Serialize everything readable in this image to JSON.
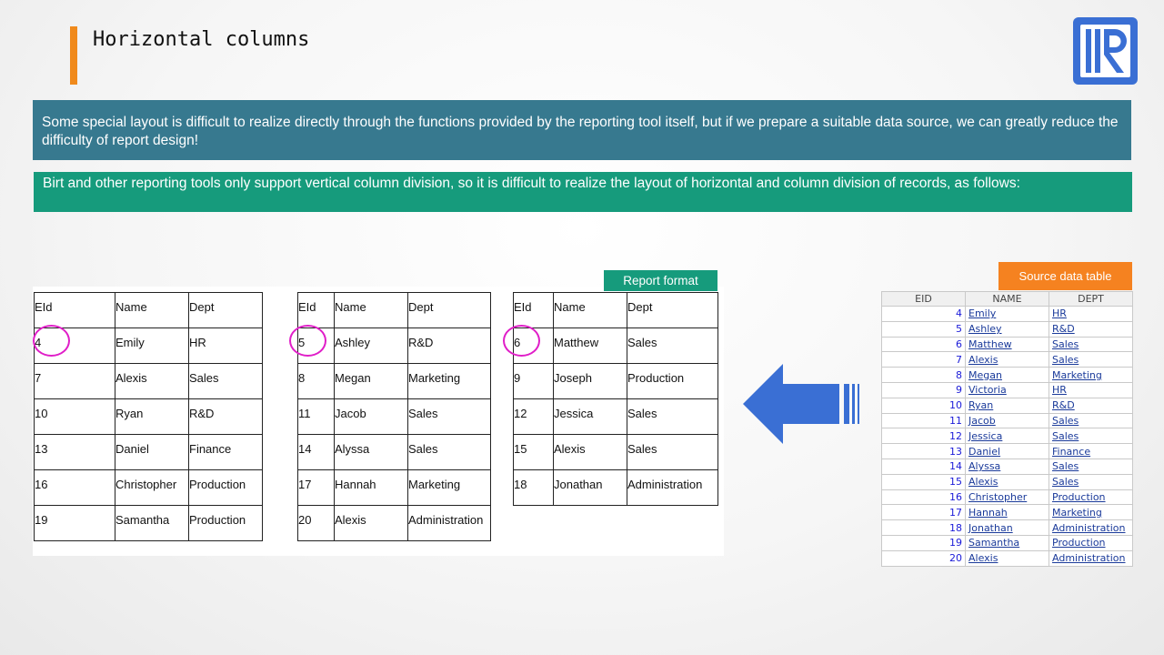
{
  "title": "Horizontal columns",
  "intro": "Some special layout is difficult to realize directly through the functions provided by the reporting tool itself, but if we prepare a suitable data source, we can greatly reduce the difficulty of report design!",
  "note": "Birt and other reporting tools only support vertical column division, so it is difficult to realize the layout of horizontal and column division of records, as follows:",
  "report_label": "Report format",
  "source_label": "Source data table",
  "report": {
    "headers": [
      "EId",
      "Name",
      "Dept"
    ],
    "groups": [
      [
        [
          "4",
          "Emily",
          "HR"
        ],
        [
          "7",
          "Alexis",
          "Sales"
        ],
        [
          "10",
          "Ryan",
          "R&D"
        ],
        [
          "13",
          "Daniel",
          "Finance"
        ],
        [
          "16",
          "Christopher",
          "Production"
        ],
        [
          "19",
          "Samantha",
          "Production"
        ]
      ],
      [
        [
          "5",
          "Ashley",
          "R&D"
        ],
        [
          "8",
          "Megan",
          "Marketing"
        ],
        [
          "11",
          "Jacob",
          "Sales"
        ],
        [
          "14",
          "Alyssa",
          "Sales"
        ],
        [
          "17",
          "Hannah",
          "Marketing"
        ],
        [
          "20",
          "Alexis",
          "Administration"
        ]
      ],
      [
        [
          "6",
          "Matthew",
          "Sales"
        ],
        [
          "9",
          "Joseph",
          "Production"
        ],
        [
          "12",
          "Jessica",
          "Sales"
        ],
        [
          "15",
          "Alexis",
          "Sales"
        ],
        [
          "18",
          "Jonathan",
          "Administration"
        ]
      ]
    ]
  },
  "source": {
    "headers": [
      "EID",
      "NAME",
      "DEPT"
    ],
    "rows": [
      [
        "4",
        "Emily",
        "HR"
      ],
      [
        "5",
        "Ashley",
        "R&D"
      ],
      [
        "6",
        "Matthew",
        "Sales"
      ],
      [
        "7",
        "Alexis",
        "Sales"
      ],
      [
        "8",
        "Megan",
        "Marketing"
      ],
      [
        "9",
        "Victoria",
        "HR"
      ],
      [
        "10",
        "Ryan",
        "R&D"
      ],
      [
        "11",
        "Jacob",
        "Sales"
      ],
      [
        "12",
        "Jessica",
        "Sales"
      ],
      [
        "13",
        "Daniel",
        "Finance"
      ],
      [
        "14",
        "Alyssa",
        "Sales"
      ],
      [
        "15",
        "Alexis",
        "Sales"
      ],
      [
        "16",
        "Christopher",
        "Production"
      ],
      [
        "17",
        "Hannah",
        "Marketing"
      ],
      [
        "18",
        "Jonathan",
        "Administration"
      ],
      [
        "19",
        "Samantha",
        "Production"
      ],
      [
        "20",
        "Alexis",
        "Administration"
      ]
    ]
  },
  "colors": {
    "accent": "#f08a1c",
    "band_blue": "#37798f",
    "band_green": "#169b7c",
    "label_orange": "#f58220",
    "arrow": "#3a6fd4",
    "circle": "#e01ec8"
  },
  "icons": {
    "logo": "runqian-r-logo",
    "arrow": "left-arrow-icon"
  }
}
